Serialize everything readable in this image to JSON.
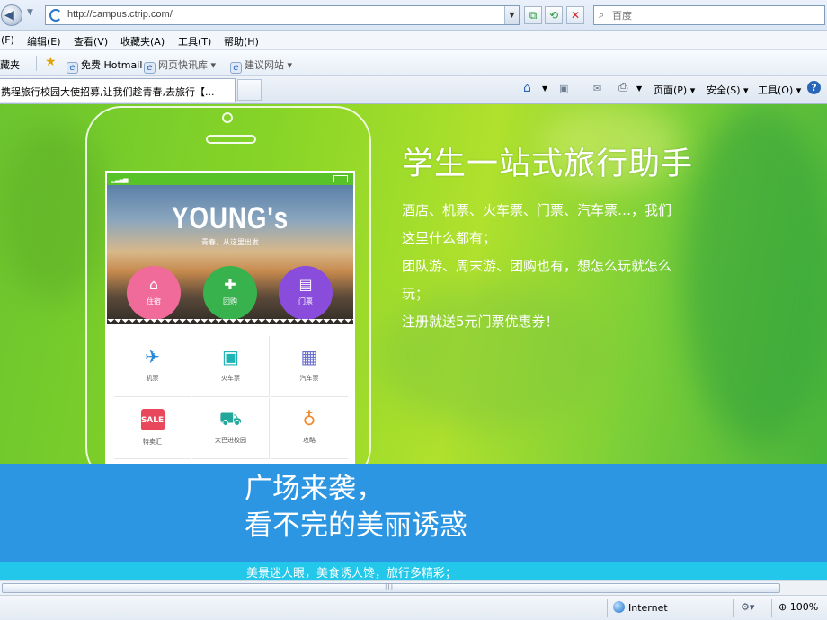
{
  "browser": {
    "url": "http://campus.ctrip.com/",
    "search_placeholder": "百度",
    "menu": [
      "(F)",
      "编辑(E)",
      "查看(V)",
      "收藏夹(A)",
      "工具(T)",
      "帮助(H)"
    ],
    "favorites_label": "收藏夹",
    "favorites": [
      "免费 Hotmail",
      "网页快讯库 ▾",
      "建议网站 ▾"
    ],
    "tab_title": "携程旅行校园大使招募,让我们趁青春,去旅行【...",
    "commands": [
      "页面(P) ▾",
      "安全(S) ▾",
      "工具(O) ▾"
    ],
    "status_zone": "Internet",
    "zoom": "100%",
    "scroll_grip": "|||"
  },
  "phone_app": {
    "hero_title": "YOUNG's",
    "hero_subtitle": "青春，从这里出发",
    "circle_buttons": [
      {
        "label": "住宿",
        "icon": "bed-icon",
        "glyph": "⌂",
        "color": "#f16b9a"
      },
      {
        "label": "团购",
        "icon": "tag-icon",
        "glyph": "✚",
        "color": "#37b24d"
      },
      {
        "label": "门票",
        "icon": "ticket-icon",
        "glyph": "▤",
        "color": "#8a4ddb"
      }
    ],
    "grid": [
      {
        "label": "机票",
        "icon": "plane-icon",
        "glyph": "✈",
        "color": "#2a8ad8"
      },
      {
        "label": "火车票",
        "icon": "train-icon",
        "glyph": "▣",
        "color": "#1eb3b5"
      },
      {
        "label": "汽车票",
        "icon": "bus-icon",
        "glyph": "▦",
        "color": "#6a6fcf"
      },
      {
        "label": "特卖汇",
        "icon": "sale-bag-icon",
        "glyph": "SALE",
        "color": "#e8475c"
      },
      {
        "label": "大巴进校园",
        "icon": "campus-bus-icon",
        "glyph": "⛟",
        "color": "#22a79a"
      },
      {
        "label": "攻略",
        "icon": "balloon-icon",
        "glyph": "♁",
        "color": "#f08a2a"
      }
    ]
  },
  "promo": {
    "headline": "学生一站式旅行助手",
    "lines": [
      "酒店、机票、火车票、门票、汽车票…，我们",
      "这里什么都有；",
      "团队游、周末游、团购也有，想怎么玩就怎么",
      "玩；",
      "注册就送5元门票优惠券！"
    ],
    "band_line1": "广场来袭，",
    "band_line2": "看不完的美丽诱惑",
    "band_caption": "美景迷人眼，美食诱人馋，旅行多精彩；"
  }
}
